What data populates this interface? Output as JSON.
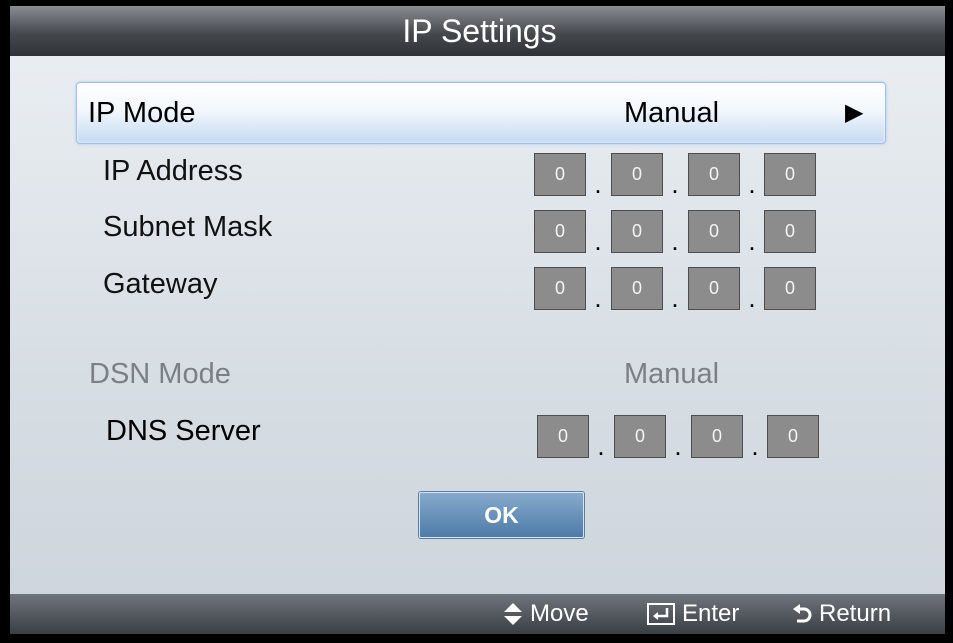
{
  "dialog": {
    "title": "IP Settings"
  },
  "ip_mode": {
    "label": "IP Mode",
    "value": "Manual",
    "arrow": "▶"
  },
  "ip_address": {
    "label": "IP Address",
    "octets": [
      "0",
      "0",
      "0",
      "0"
    ]
  },
  "subnet_mask": {
    "label": "Subnet Mask",
    "octets": [
      "0",
      "0",
      "0",
      "0"
    ]
  },
  "gateway": {
    "label": "Gateway",
    "octets": [
      "0",
      "0",
      "0",
      "0"
    ]
  },
  "dns_mode": {
    "label": "DSN Mode",
    "value": "Manual"
  },
  "dns_server": {
    "label": "DNS Server",
    "octets": [
      "0",
      "0",
      "0",
      "0"
    ]
  },
  "separator": ".",
  "ok_button": {
    "label": "OK"
  },
  "footer": {
    "move": {
      "label": "Move",
      "icon": "up-down-arrow-icon"
    },
    "enter": {
      "label": "Enter",
      "icon": "enter-icon"
    },
    "return": {
      "label": "Return",
      "icon": "return-icon"
    }
  },
  "colors": {
    "highlight": "#c6daf2",
    "ok_button": "#4e7ba7",
    "octet_box": "#8c8c8c",
    "dim_text": "#7c8086"
  }
}
